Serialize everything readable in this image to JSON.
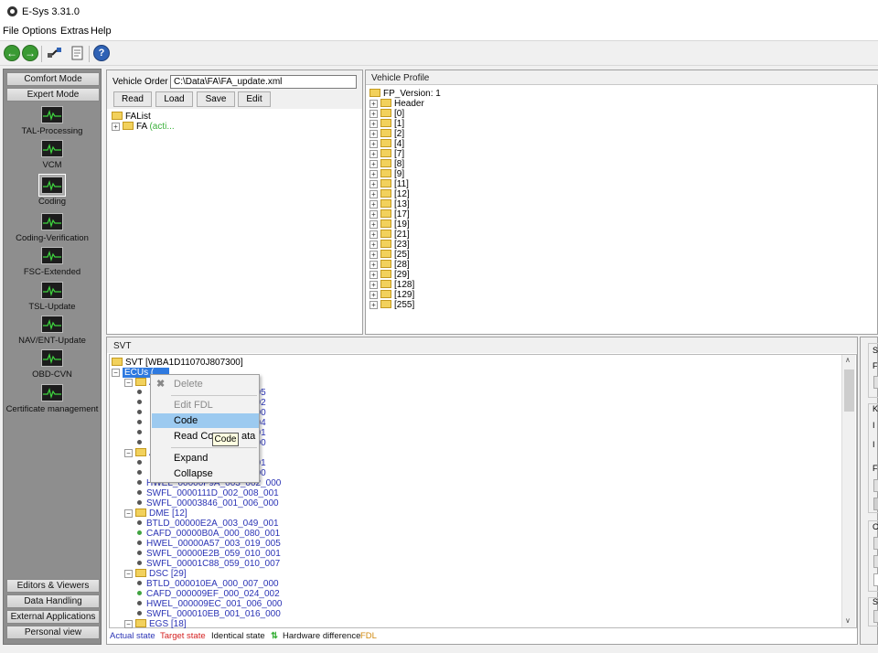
{
  "window": {
    "title": "E-Sys 3.31.0"
  },
  "menu": [
    "File",
    "Options",
    "Extras",
    "Help"
  ],
  "toolbar": {
    "icons": [
      "back-icon",
      "forward-icon",
      "connect-icon",
      "document-icon",
      "help-icon"
    ]
  },
  "leftnav": {
    "top_buttons": [
      "Comfort Mode",
      "Expert Mode"
    ],
    "items": [
      "TAL-Processing",
      "VCM",
      "Coding",
      "Coding-Verification",
      "FSC-Extended",
      "TSL-Update",
      "NAV/ENT-Update",
      "OBD-CVN",
      "Certificate management"
    ],
    "selected": "Coding",
    "bottom_buttons": [
      "Editors & Viewers",
      "Data Handling",
      "External Applications",
      "Personal view"
    ]
  },
  "vehicle_order": {
    "label": "Vehicle Order",
    "path": "C:\\Data\\FA\\FA_update.xml",
    "buttons": [
      "Read",
      "Load",
      "Save",
      "Edit"
    ],
    "tree_root": "FAList",
    "tree_child": "FA",
    "tree_child_note": "(acti..."
  },
  "vehicle_profile": {
    "header": "Vehicle Profile",
    "root": "FP_Version: 1",
    "nodes": [
      "Header",
      "[0]",
      "[1]",
      "[2]",
      "[4]",
      "[7]",
      "[8]",
      "[9]",
      "[11]",
      "[12]",
      "[13]",
      "[17]",
      "[19]",
      "[21]",
      "[23]",
      "[25]",
      "[28]",
      "[29]",
      "[128]",
      "[129]",
      "[255]"
    ]
  },
  "svt": {
    "header": "SVT",
    "root": "SVT [WBA1D11070J807300]",
    "ecus_label": "ECUs (",
    "group1_partial": [
      "005",
      "002",
      "000",
      "004",
      "001",
      "000"
    ],
    "group2_partial": [
      "001",
      "000"
    ],
    "group2_rows": [
      "HWEL_00000F9A_003_002_000",
      "SWFL_0000111D_002_008_001",
      "SWFL_00003846_001_006_000"
    ],
    "group_a": "A",
    "dme": {
      "label": "DME [12]",
      "rows": [
        {
          "text": "BTLD_00000E2A_003_049_001",
          "dot": "dark"
        },
        {
          "text": "CAFD_00000B0A_000_080_001",
          "dot": "green"
        },
        {
          "text": "HWEL_00000A57_003_019_005",
          "dot": "dark"
        },
        {
          "text": "SWFL_00000E2B_059_010_001",
          "dot": "dark"
        },
        {
          "text": "SWFL_00001C88_059_010_007",
          "dot": "dark"
        }
      ]
    },
    "dsc": {
      "label": "DSC [29]",
      "rows": [
        {
          "text": "BTLD_000010EA_000_007_000",
          "dot": "dark"
        },
        {
          "text": "CAFD_000009EF_000_024_002",
          "dot": "green"
        },
        {
          "text": "HWEL_000009EC_001_006_000",
          "dot": "dark"
        },
        {
          "text": "SWFL_000010EB_001_016_000",
          "dot": "dark"
        }
      ]
    },
    "egs": {
      "label": "EGS [18]"
    }
  },
  "context_menu": {
    "items": [
      {
        "label": "Delete",
        "enabled": false
      },
      {
        "label": "Edit FDL",
        "enabled": false
      },
      {
        "label": "Code",
        "enabled": true,
        "highlighted": true
      },
      {
        "label": "Read Coding Data",
        "visible_label": "Read Co",
        "visible_tail": "ata",
        "enabled": true
      },
      {
        "label": "Expand",
        "enabled": true
      },
      {
        "label": "Collapse",
        "enabled": true
      }
    ],
    "tooltip": "Code"
  },
  "legend": {
    "actual": "Actual state",
    "target": "Target state",
    "identical": "Identical state",
    "hardware": "Hardware difference",
    "fdl": "FDL",
    "colors": {
      "actual": "#2b34b5",
      "target": "#d42020",
      "identical": "#111111",
      "fdl": "#d08a10"
    }
  },
  "right_edge": {
    "letters": [
      "S",
      "F",
      "K",
      "I",
      "I",
      "F",
      "C",
      "S"
    ]
  }
}
